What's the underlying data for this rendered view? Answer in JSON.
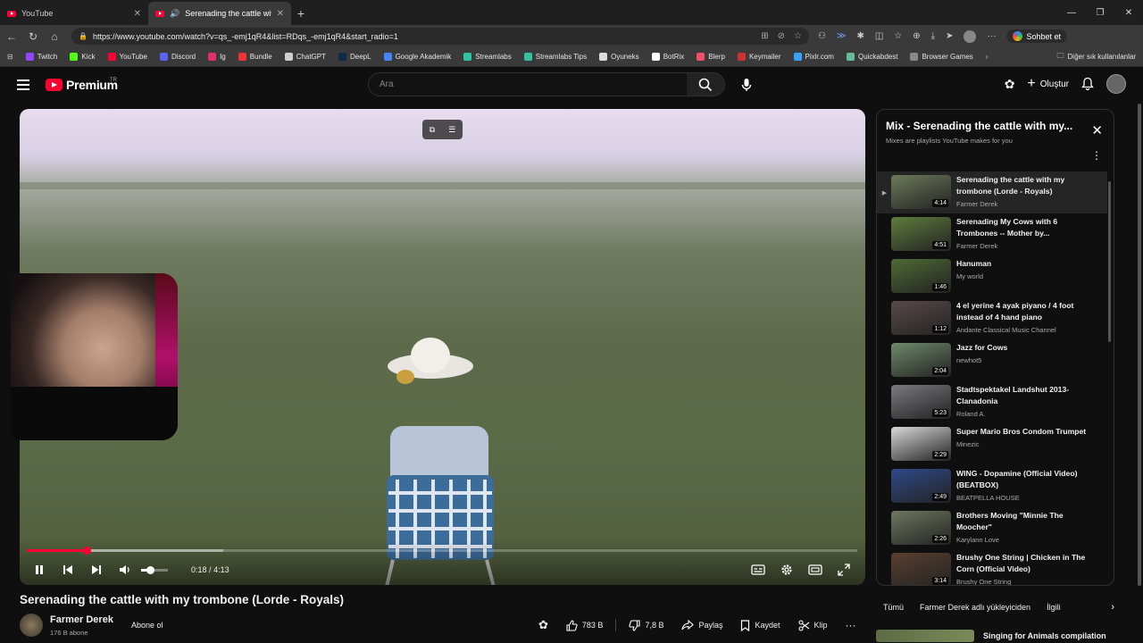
{
  "browser": {
    "tabs": [
      {
        "label": "YouTube"
      },
      {
        "label": "Serenading the cattle with my"
      }
    ],
    "url": "https://www.youtube.com/watch?v=qs_-emj1qR4&list=RDqs_-emj1qR4&start_radio=1",
    "copilot_label": "Sohbet et",
    "bookmarks": [
      {
        "label": "Twitch",
        "color": "#9146ff"
      },
      {
        "label": "Kick",
        "color": "#53fc18"
      },
      {
        "label": "YouTube",
        "color": "#ff0033"
      },
      {
        "label": "Discord",
        "color": "#5865f2"
      },
      {
        "label": "Ig",
        "color": "#e1306c"
      },
      {
        "label": "Bundle",
        "color": "#e33"
      },
      {
        "label": "ChatGPT",
        "color": "#cfcfcf"
      },
      {
        "label": "DeepL",
        "color": "#0f2b46"
      },
      {
        "label": "Google Akademik",
        "color": "#4285f4"
      },
      {
        "label": "Streamlabs",
        "color": "#31c3a2"
      },
      {
        "label": "Streamlabs Tips",
        "color": "#31c3a2"
      },
      {
        "label": "Oyuneks",
        "color": "#ddd"
      },
      {
        "label": "BotRix",
        "color": "#fff"
      },
      {
        "label": "Blerp",
        "color": "#f0506e"
      },
      {
        "label": "Keymailer",
        "color": "#c33"
      },
      {
        "label": "Pixlr.com",
        "color": "#3aa0ff"
      },
      {
        "label": "Quickabdest",
        "color": "#6b9"
      },
      {
        "label": "Browser Games",
        "color": "#888"
      }
    ],
    "other_bookmarks": "Diğer sık kullanılanlar"
  },
  "header": {
    "logo": "Premium",
    "logo_region": "TR",
    "search_placeholder": "Ara",
    "create_label": "Oluştur"
  },
  "player": {
    "progress_played_fraction": 0.072,
    "buffered_fraction": 0.237,
    "volume_fraction": 0.33,
    "time_current": "0:18",
    "time_separator": "/",
    "time_total": "4:13"
  },
  "video": {
    "title": "Serenading the cattle with my trombone (Lorde - Royals)",
    "channel": "Farmer Derek",
    "subscribers": "176 B abone",
    "subscribe_label": "Abone ol",
    "likes": "783 B",
    "dislikes": "7,8 B",
    "share_label": "Paylaş",
    "save_label": "Kaydet",
    "clip_label": "Klip"
  },
  "playlist": {
    "title": "Mix - Serenading the cattle with my...",
    "subtitle": "Mixes are playlists YouTube makes for you",
    "items": [
      {
        "title": "Serenading the cattle with my trombone (Lorde - Royals)",
        "channel": "Farmer Derek",
        "duration": "4:14",
        "color": "#6d7a5a",
        "active": true
      },
      {
        "title": "Serenading My Cows with 6 Trombones -- Mother by...",
        "channel": "Farmer Derek",
        "duration": "4:51",
        "color": "#5f7d3e"
      },
      {
        "title": "Hanuman",
        "channel": "My world",
        "duration": "1:46",
        "color": "#4e6b35"
      },
      {
        "title": "4 el yerine 4 ayak piyano / 4 foot instead of 4 hand piano",
        "channel": "Andante Classical Music Channel",
        "duration": "1:12",
        "color": "#5a4a4a"
      },
      {
        "title": "Jazz for Cows",
        "channel": "newhot5",
        "duration": "2:04",
        "color": "#6e8a6a"
      },
      {
        "title": "Stadtspektakel Landshut 2013- Clanadonia",
        "channel": "Roland A.",
        "duration": "5:23",
        "color": "#7a7a80"
      },
      {
        "title": "Super Mario Bros Condom Trumpet",
        "channel": "Minezic",
        "duration": "2:29",
        "color": "#d8d8d8"
      },
      {
        "title": "WING - Dopamine (Official Video) (BEATBOX)",
        "channel": "BEATPELLA HOUSE",
        "duration": "2:49",
        "color": "#2f4a8a"
      },
      {
        "title": "Brothers Moving \"Minnie The Moocher\"",
        "channel": "Karylann Love",
        "duration": "2:26",
        "color": "#6e7860"
      },
      {
        "title": "Brushy One String | Chicken in The Corn (Official Video)",
        "channel": "Brushy One String",
        "duration": "3:14",
        "color": "#5a4030"
      }
    ]
  },
  "chips": [
    "Tümü",
    "Farmer Derek adlı yükleyiciden",
    "İlgili"
  ],
  "next_item": {
    "title": "Singing for Animals compilation"
  }
}
